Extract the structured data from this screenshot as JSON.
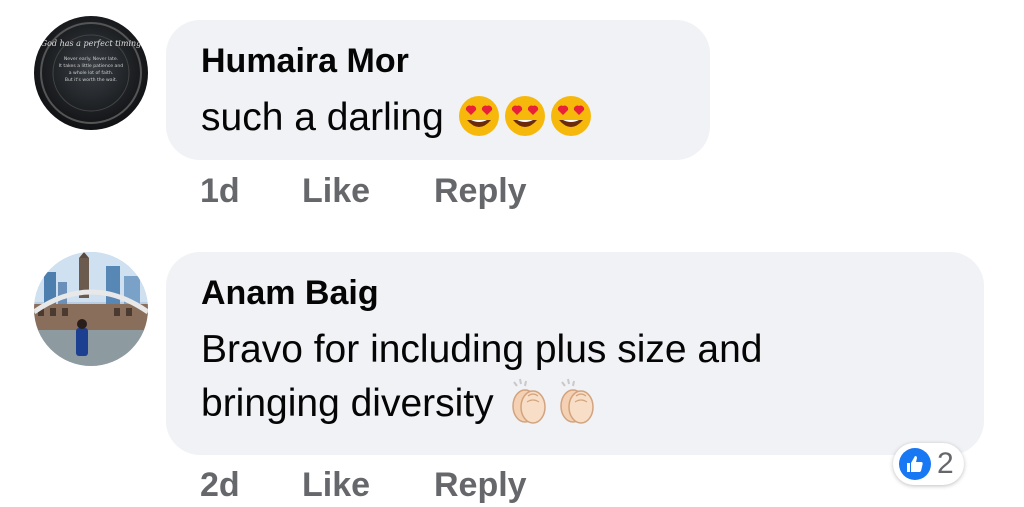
{
  "comments": [
    {
      "author": "Humaira Mor",
      "text": "such a darling",
      "emoji": [
        "heart-eyes",
        "heart-eyes",
        "heart-eyes"
      ],
      "time": "1d",
      "like_label": "Like",
      "reply_label": "Reply",
      "avatar_icon": "quote-image-avatar",
      "avatar_text": {
        "script": "God has a perfect timing",
        "lines": [
          "Never early. Never late.",
          "It takes a little patience and",
          "a whole lot of faith.",
          "But it's worth the wait."
        ]
      }
    },
    {
      "author": "Anam Baig",
      "text_lines": [
        "Bravo for including plus size and",
        "bringing diversity"
      ],
      "emoji": [
        "clapping-hands",
        "clapping-hands"
      ],
      "time": "2d",
      "like_label": "Like",
      "reply_label": "Reply",
      "avatar_icon": "city-photo-avatar",
      "reactions": {
        "icon": "thumbs-up-icon",
        "count": "2"
      }
    }
  ],
  "colors": {
    "bubble": "#f0f2f5",
    "meta_text": "#65676b",
    "name_text": "#050505",
    "like_blue": "#1877f2"
  }
}
